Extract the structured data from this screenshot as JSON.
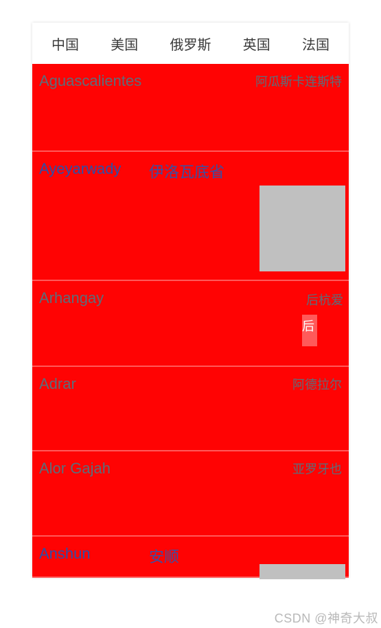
{
  "tabs": {
    "items": [
      {
        "label": "中国"
      },
      {
        "label": "美国"
      },
      {
        "label": "俄罗斯"
      },
      {
        "label": "英国"
      },
      {
        "label": "法国"
      }
    ]
  },
  "list": {
    "rows": [
      {
        "en": "Aguascalientes",
        "cn": "阿瓜斯卡连斯特",
        "highlighted": false
      },
      {
        "en": "Ayeyarwady",
        "cn": "伊洛瓦底省",
        "highlighted": true,
        "image": true
      },
      {
        "en": "Arhangay",
        "cn": "后杭爱",
        "highlighted": false
      },
      {
        "en": "Adrar",
        "cn": "阿德拉尔",
        "highlighted": false
      },
      {
        "en": "Alor Gajah",
        "cn": "亚罗牙也",
        "highlighted": false
      },
      {
        "en": "Anshun",
        "cn": "安顺",
        "highlighted": true,
        "image": true
      }
    ]
  },
  "overlay": {
    "highlight_text": "后"
  },
  "watermark": "CSDN @神奇大叔"
}
